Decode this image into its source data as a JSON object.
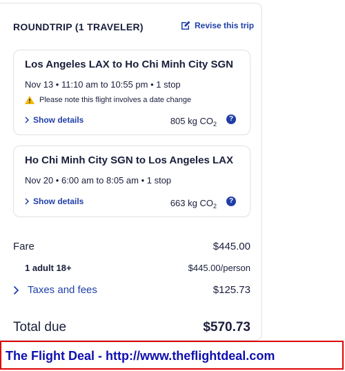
{
  "header": {
    "title": "ROUNDTRIP (1 TRAVELER)",
    "revise_label": "Revise this trip"
  },
  "flights": [
    {
      "route": "Los Angeles LAX to Ho Chi Minh City SGN",
      "times": "Nov 13 • 11:10 am to 10:55 pm • 1 stop",
      "warning": "Please note this flight involves a date change",
      "details_label": "Show details",
      "co2_value": "805 kg CO",
      "co2_sub": "2"
    },
    {
      "route": "Ho Chi Minh City SGN to Los Angeles LAX",
      "times": "Nov 20 • 6:00 am to 8:05 am • 1 stop",
      "details_label": "Show details",
      "co2_value": "663 kg CO",
      "co2_sub": "2"
    }
  ],
  "price": {
    "fare_label": "Fare",
    "fare_value": "$445.00",
    "adult_label": "1 adult 18+",
    "adult_value": "$445.00/person",
    "taxes_label": "Taxes and fees",
    "taxes_value": "$125.73",
    "total_label": "Total due",
    "total_value": "$570.73"
  },
  "banner": {
    "text": "The Flight Deal - http://www.theflightdeal.com"
  },
  "colors": {
    "link": "#1f3ea8",
    "text": "#191e3b",
    "warning": "#f2b705",
    "banner_border": "#e00000",
    "banner_text": "#0f0fb0"
  },
  "icons": [
    "edit-icon",
    "warning-icon",
    "chevron-right-icon",
    "help-icon"
  ]
}
